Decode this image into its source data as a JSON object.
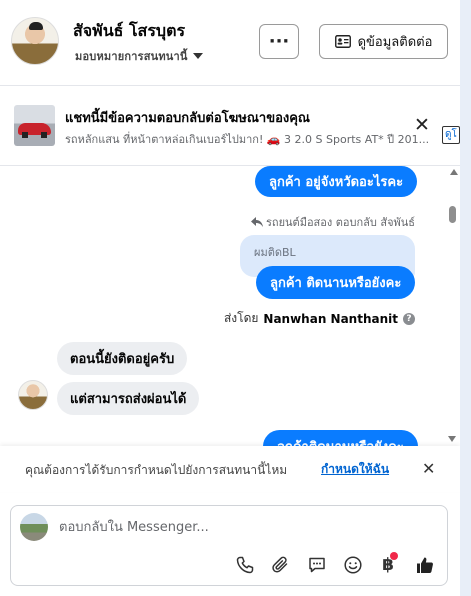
{
  "header": {
    "name": "สัจพันธ์ โสรบุตร",
    "subtitle": "มอบหมายการสนทนานี้",
    "contact_button": "ดูข้อมูลติดต่อ"
  },
  "ad": {
    "title": "แชทนี้มีข้อความตอบกลับต่อโฆษณาของคุณ",
    "subtitle": "รถหลักแสน ที่หน้าตาหล่อเกินเบอร์ไปมาก! 🚗 3 2.0 S Sports AT* ปี 201...",
    "peek_label": "ดูโ"
  },
  "messages": {
    "out1": "ลูกค้า อยู่จังหวัดอะไรคะ",
    "reply_meta": "รถยนต์มือสอง ตอบกลับ สัจพันธ์",
    "quoted": "ผมติดBL",
    "out2": "ลูกค้า  ติดนานหรือยังคะ",
    "sent_by_prefix": "ส่งโดย",
    "sent_by_name": "Nanwhan Nanthanit",
    "in1": "ตอนนี้ยังติดอยู่ครับ",
    "in2": "แต่สามารถส่งผ่อนได้",
    "out3": "ลูกค้าติดนานหรือยังคะ"
  },
  "notice": {
    "text": "คุณต้องการได้รับการกำหนดไปยังการสนทนานี้ไหม",
    "link": "กำหนดให้ฉัน"
  },
  "composer": {
    "placeholder": "ตอบกลับใน Messenger...",
    "baht_symbol": "฿"
  },
  "colors": {
    "accent": "#0a7cff",
    "link": "#0064d1",
    "incoming_bubble": "#eceef1",
    "quoted_bubble": "#dce9fb",
    "notification_dot": "#f02849"
  },
  "icons": [
    "more-icon",
    "contact-card-icon",
    "close-icon",
    "reply-arrow-icon",
    "info-icon",
    "phone-icon",
    "attachment-icon",
    "saved-reply-icon",
    "emoji-icon",
    "baht-icon",
    "thumbs-up-icon"
  ]
}
